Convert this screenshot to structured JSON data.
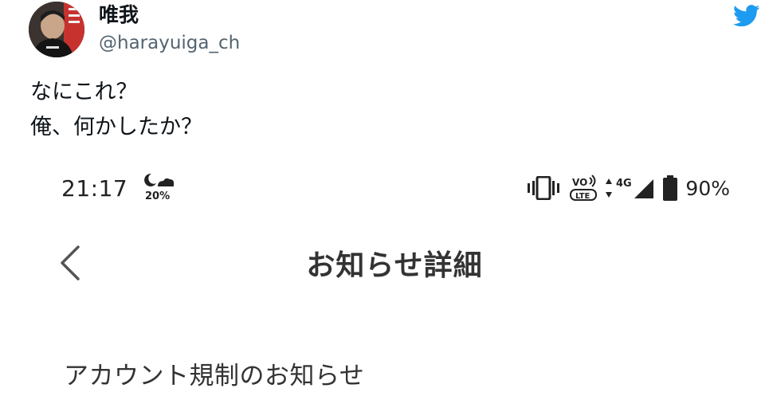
{
  "tweet": {
    "display_name": "唯我",
    "handle": "@harayuiga_ch",
    "text_lines": [
      "なにこれ？",
      "俺、何かしたか？"
    ],
    "brand_color": "#1d9bf0",
    "brand_icon": "twitter-bird-icon"
  },
  "screenshot": {
    "status_bar": {
      "time": "21:17",
      "weather_icon": "moon-cloud-icon",
      "weather_temp": "20%",
      "vibrate_icon": "vibrate-icon",
      "volte_icon": "volte-icon",
      "network_label": "4G",
      "signal_icon": "signal-icon",
      "battery_icon": "battery-icon",
      "battery_percent": "90%"
    },
    "nav": {
      "back_icon": "chevron-left-icon",
      "title": "お知らせ詳細"
    },
    "notice": {
      "title": "アカウント規制のお知らせ"
    }
  }
}
